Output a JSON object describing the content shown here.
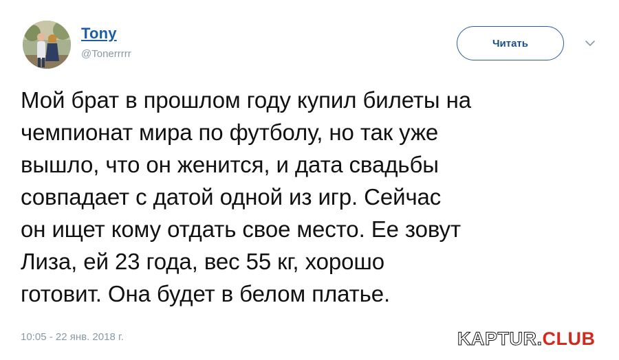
{
  "tweet": {
    "author": {
      "name": "Tony",
      "handle": "@Tonerrrrr"
    },
    "follow_label": "Читать",
    "text_lines": [
      "Мой брат в прошлом году купил билеты на",
      "чемпионат мира по футболу, но так уже",
      "вышло, что он женится, и дата свадьбы",
      "совпадает с датой одной из игр. Сейчас",
      "он ищет кому отдать свое место. Ее зовут",
      "Лиза, ей 23 года, вес 55 кг, хорошо",
      "готовит. Она будет в белом платье."
    ],
    "timestamp": "10:05 - 22 янв. 2018 г."
  },
  "watermark": {
    "main": "KAPTUR.",
    "accent": "CLUB"
  },
  "colors": {
    "name_link": "#1b5ea8",
    "button_border": "#2b5ea0",
    "muted_text": "#8899a6",
    "watermark_accent": "#d42a1e"
  }
}
